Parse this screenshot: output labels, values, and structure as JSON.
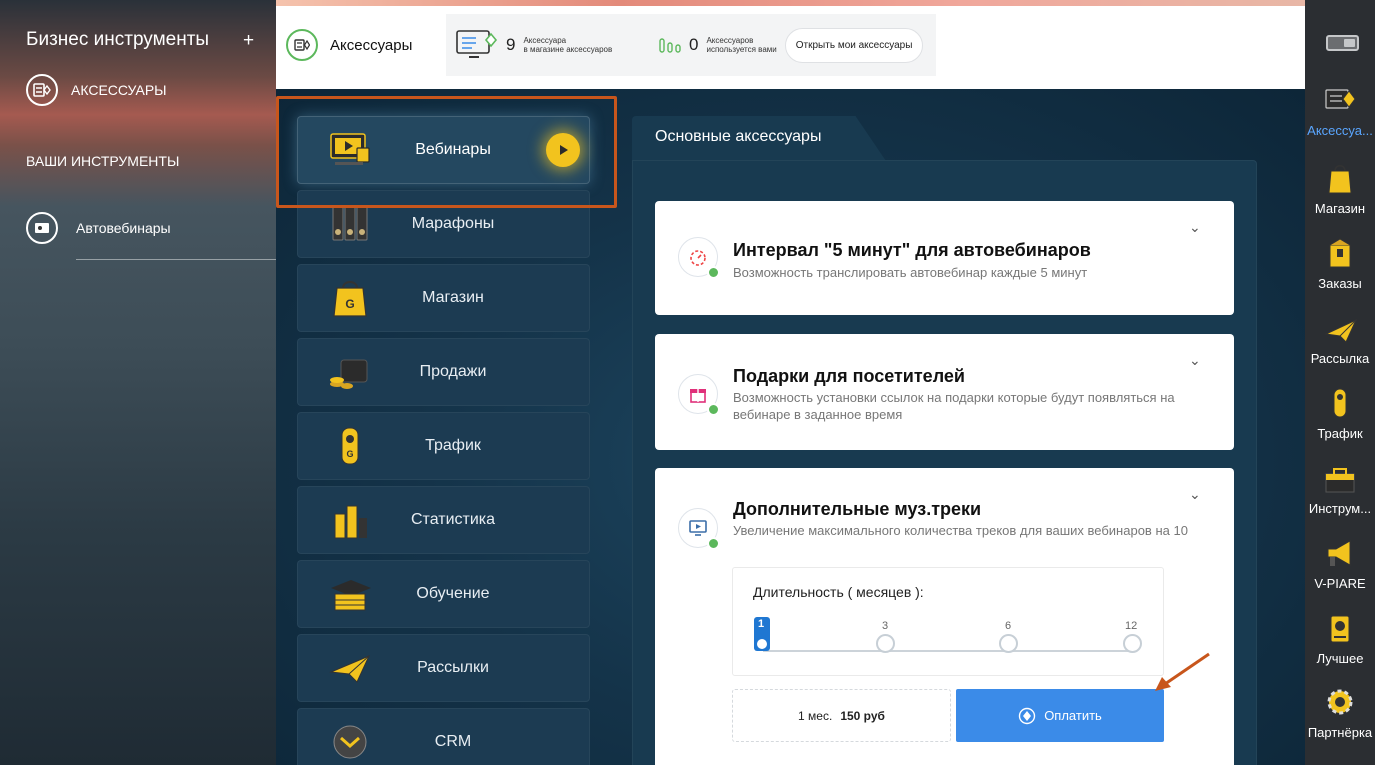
{
  "left_sidebar": {
    "title": "Бизнес инструменты",
    "add_symbol": "+",
    "accessories_label": "АКСЕССУАРЫ",
    "section_title": "ВАШИ ИНСТРУМЕНТЫ",
    "tools": [
      {
        "label": "Автовебинары"
      }
    ]
  },
  "topbar": {
    "accessories_title": "Аксессуары",
    "store_count": "9",
    "store_caption_1": "Аксессуара",
    "store_caption_2": "в магазине аксессуаров",
    "used_count": "0",
    "used_caption_1": "Аксессуаров",
    "used_caption_2": "используется вами",
    "open_button": "Открыть мои аксессуары"
  },
  "categories": [
    {
      "label": "Вебинары",
      "active": true
    },
    {
      "label": "Марафоны"
    },
    {
      "label": "Магазин"
    },
    {
      "label": "Продажи"
    },
    {
      "label": "Трафик"
    },
    {
      "label": "Статистика"
    },
    {
      "label": "Обучение"
    },
    {
      "label": "Рассылки"
    },
    {
      "label": "CRM"
    }
  ],
  "panel": {
    "tab_title": "Основные аксессуары",
    "cards": [
      {
        "title": "Интервал \"5 минут\" для автовебинаров",
        "desc": "Возможность транслировать автовебинар каждые 5 минут"
      },
      {
        "title": "Подарки для посетителей",
        "desc": "Возможность установки ссылок на подарки которые будут появляться на вебинаре в заданное время"
      },
      {
        "title": "Дополнительные муз.треки",
        "desc": "Увеличение максимального количества треков для ваших вебинаров на 10"
      }
    ],
    "duration_label": "Длительность ( месяцев ):",
    "duration_options": [
      "1",
      "3",
      "6",
      "12"
    ],
    "selected_duration": "1",
    "price_period": "1 мес.",
    "price_value": "150 руб",
    "pay_button": "Оплатить"
  },
  "right_sidebar": {
    "items": [
      {
        "label": "Аксессуа...",
        "icon": "accessories-icon",
        "active": true
      },
      {
        "label": "Магазин",
        "icon": "shop-bag-icon"
      },
      {
        "label": "Заказы",
        "icon": "orders-box-icon"
      },
      {
        "label": "Рассылка",
        "icon": "paper-plane-icon"
      },
      {
        "label": "Трафик",
        "icon": "traffic-light-icon"
      },
      {
        "label": "Инструм...",
        "icon": "toolbox-icon"
      },
      {
        "label": "V-PIARE",
        "icon": "megaphone-icon"
      },
      {
        "label": "Лучшее",
        "icon": "best-icon"
      },
      {
        "label": "Партнёрка",
        "icon": "gear-icon"
      }
    ]
  },
  "colors": {
    "accent_blue": "#3b8be8",
    "highlight_orange": "#c8561c",
    "gold": "#f2c31e",
    "green": "#5cb85c"
  }
}
